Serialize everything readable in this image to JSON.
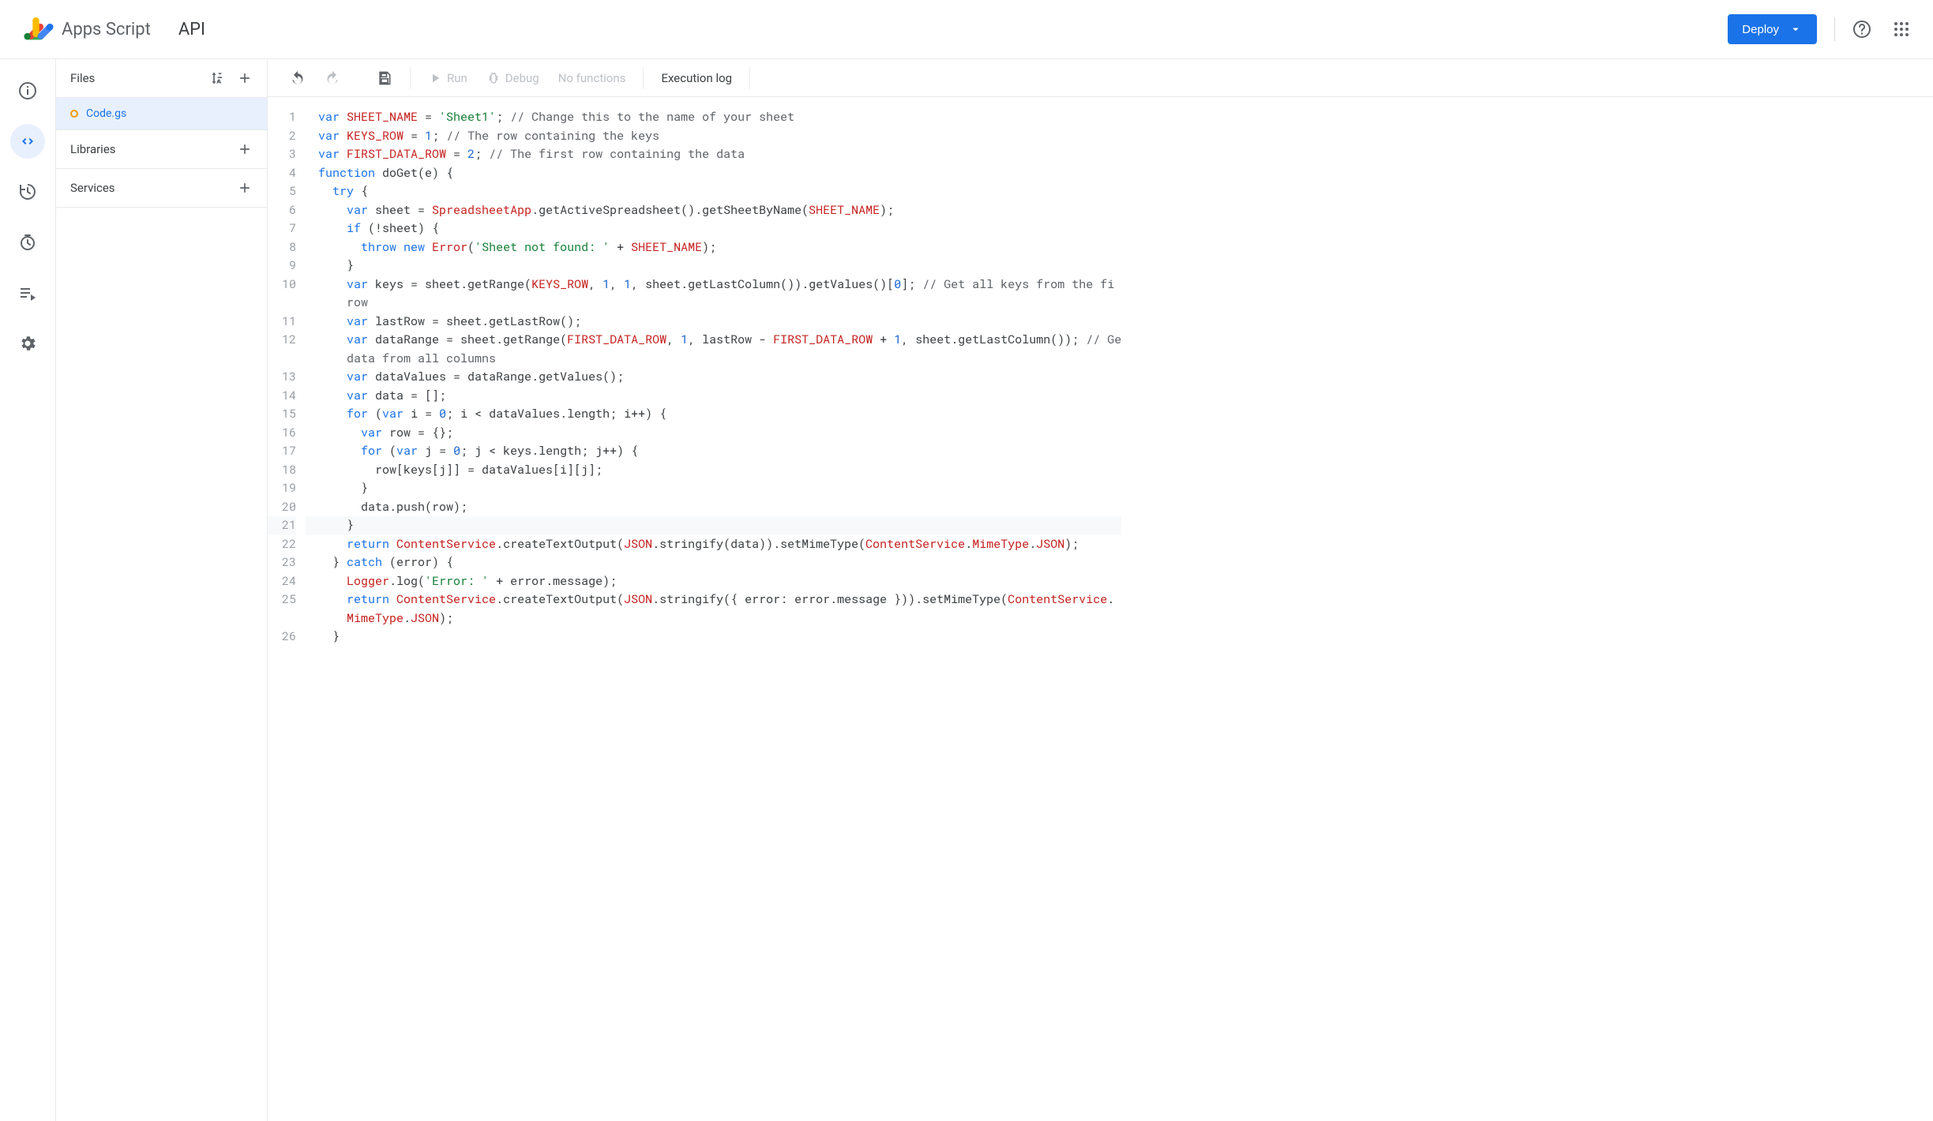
{
  "header": {
    "product": "Apps Script",
    "project_title": "API",
    "deploy_label": "Deploy"
  },
  "rail": {
    "items": [
      "overview",
      "editor",
      "triggers",
      "executions",
      "project-settings",
      "settings"
    ]
  },
  "files_panel": {
    "files_label": "Files",
    "libraries_label": "Libraries",
    "services_label": "Services",
    "file_items": [
      {
        "name": "Code.gs",
        "status": "unsaved"
      }
    ]
  },
  "toolbar": {
    "run_label": "Run",
    "debug_label": "Debug",
    "no_functions_label": "No functions",
    "execution_log_label": "Execution log"
  },
  "editor": {
    "line_numbers": [
      "1",
      "2",
      "3",
      "4",
      "5",
      "6",
      "7",
      "8",
      "9",
      "10",
      "",
      "11",
      "12",
      "",
      "13",
      "14",
      "15",
      "16",
      "17",
      "18",
      "19",
      "20",
      "21",
      "22",
      "23",
      "24",
      "25",
      "",
      "26"
    ],
    "current_line_index": 22,
    "code_lines": [
      [
        {
          "t": "var ",
          "c": "kw"
        },
        {
          "t": "SHEET_NAME",
          "c": "ident"
        },
        {
          "t": " = "
        },
        {
          "t": "'Sheet1'",
          "c": "str"
        },
        {
          "t": "; "
        },
        {
          "t": "// Change this to the name of your sheet",
          "c": "cmt"
        }
      ],
      [
        {
          "t": "var ",
          "c": "kw"
        },
        {
          "t": "KEYS_ROW",
          "c": "ident"
        },
        {
          "t": " = "
        },
        {
          "t": "1",
          "c": "num"
        },
        {
          "t": "; "
        },
        {
          "t": "// The row containing the keys",
          "c": "cmt"
        }
      ],
      [
        {
          "t": "var ",
          "c": "kw"
        },
        {
          "t": "FIRST_DATA_ROW",
          "c": "ident"
        },
        {
          "t": " = "
        },
        {
          "t": "2",
          "c": "num"
        },
        {
          "t": "; "
        },
        {
          "t": "// The first row containing the data",
          "c": "cmt"
        }
      ],
      [
        {
          "t": "function ",
          "c": "kw"
        },
        {
          "t": "doGet"
        },
        {
          "t": "(e) {"
        }
      ],
      [
        {
          "t": "  "
        },
        {
          "t": "try ",
          "c": "kw"
        },
        {
          "t": "{"
        }
      ],
      [
        {
          "t": "    "
        },
        {
          "t": "var ",
          "c": "kw"
        },
        {
          "t": "sheet = "
        },
        {
          "t": "SpreadsheetApp",
          "c": "ident"
        },
        {
          "t": ".getActiveSpreadsheet().getSheetByName("
        },
        {
          "t": "SHEET_NAME",
          "c": "ident"
        },
        {
          "t": ");"
        }
      ],
      [
        {
          "t": "    "
        },
        {
          "t": "if ",
          "c": "kw"
        },
        {
          "t": "(!sheet) {"
        }
      ],
      [
        {
          "t": "      "
        },
        {
          "t": "throw new ",
          "c": "kw"
        },
        {
          "t": "Error",
          "c": "err"
        },
        {
          "t": "("
        },
        {
          "t": "'Sheet not found: '",
          "c": "str"
        },
        {
          "t": " + "
        },
        {
          "t": "SHEET_NAME",
          "c": "ident"
        },
        {
          "t": ");"
        }
      ],
      [
        {
          "t": "    }"
        }
      ],
      [
        {
          "t": "    "
        },
        {
          "t": "var ",
          "c": "kw"
        },
        {
          "t": "keys = sheet.getRange("
        },
        {
          "t": "KEYS_ROW",
          "c": "ident"
        },
        {
          "t": ", "
        },
        {
          "t": "1",
          "c": "num"
        },
        {
          "t": ", "
        },
        {
          "t": "1",
          "c": "num"
        },
        {
          "t": ", sheet.getLastColumn()).getValues()["
        },
        {
          "t": "0",
          "c": "num"
        },
        {
          "t": "]; "
        },
        {
          "t": "// Get all keys from the fi",
          "c": "cmt"
        }
      ],
      [
        {
          "t": "    "
        },
        {
          "t": "row",
          "c": "cmt"
        }
      ],
      [
        {
          "t": "    "
        },
        {
          "t": "var ",
          "c": "kw"
        },
        {
          "t": "lastRow = sheet.getLastRow();"
        }
      ],
      [
        {
          "t": "    "
        },
        {
          "t": "var ",
          "c": "kw"
        },
        {
          "t": "dataRange = sheet.getRange("
        },
        {
          "t": "FIRST_DATA_ROW",
          "c": "ident"
        },
        {
          "t": ", "
        },
        {
          "t": "1",
          "c": "num"
        },
        {
          "t": ", lastRow - "
        },
        {
          "t": "FIRST_DATA_ROW",
          "c": "ident"
        },
        {
          "t": " + "
        },
        {
          "t": "1",
          "c": "num"
        },
        {
          "t": ", sheet.getLastColumn()); "
        },
        {
          "t": "// Ge",
          "c": "cmt"
        }
      ],
      [
        {
          "t": "    "
        },
        {
          "t": "data from all columns",
          "c": "cmt"
        }
      ],
      [
        {
          "t": "    "
        },
        {
          "t": "var ",
          "c": "kw"
        },
        {
          "t": "dataValues = dataRange.getValues();"
        }
      ],
      [
        {
          "t": "    "
        },
        {
          "t": "var ",
          "c": "kw"
        },
        {
          "t": "data = [];"
        }
      ],
      [
        {
          "t": "    "
        },
        {
          "t": "for ",
          "c": "kw"
        },
        {
          "t": "("
        },
        {
          "t": "var ",
          "c": "kw"
        },
        {
          "t": "i = "
        },
        {
          "t": "0",
          "c": "num"
        },
        {
          "t": "; i < dataValues.length; i++) {"
        }
      ],
      [
        {
          "t": "      "
        },
        {
          "t": "var ",
          "c": "kw"
        },
        {
          "t": "row = {};"
        }
      ],
      [
        {
          "t": "      "
        },
        {
          "t": "for ",
          "c": "kw"
        },
        {
          "t": "("
        },
        {
          "t": "var ",
          "c": "kw"
        },
        {
          "t": "j = "
        },
        {
          "t": "0",
          "c": "num"
        },
        {
          "t": "; j < keys.length; j++) {"
        }
      ],
      [
        {
          "t": "        row[keys[j]] = dataValues[i][j];"
        }
      ],
      [
        {
          "t": "      }"
        }
      ],
      [
        {
          "t": "      data.push(row);"
        }
      ],
      [
        {
          "t": "    }"
        }
      ],
      [
        {
          "t": "    "
        },
        {
          "t": "return ",
          "c": "kw"
        },
        {
          "t": "ContentService",
          "c": "ident"
        },
        {
          "t": ".createTextOutput("
        },
        {
          "t": "JSON",
          "c": "ident"
        },
        {
          "t": ".stringify(data)).setMimeType("
        },
        {
          "t": "ContentService",
          "c": "ident"
        },
        {
          "t": "."
        },
        {
          "t": "MimeType",
          "c": "ident"
        },
        {
          "t": "."
        },
        {
          "t": "JSON",
          "c": "ident"
        },
        {
          "t": ");"
        }
      ],
      [
        {
          "t": "  } "
        },
        {
          "t": "catch ",
          "c": "kw"
        },
        {
          "t": "(error) {"
        }
      ],
      [
        {
          "t": "    "
        },
        {
          "t": "Logger",
          "c": "ident"
        },
        {
          "t": ".log("
        },
        {
          "t": "'Error: '",
          "c": "str"
        },
        {
          "t": " + error.message);"
        }
      ],
      [
        {
          "t": "    "
        },
        {
          "t": "return ",
          "c": "kw"
        },
        {
          "t": "ContentService",
          "c": "ident"
        },
        {
          "t": ".createTextOutput("
        },
        {
          "t": "JSON",
          "c": "ident"
        },
        {
          "t": ".stringify({ error: error.message })).setMimeType("
        },
        {
          "t": "ContentService",
          "c": "ident"
        },
        {
          "t": "."
        }
      ],
      [
        {
          "t": "    "
        },
        {
          "t": "MimeType",
          "c": "ident"
        },
        {
          "t": "."
        },
        {
          "t": "JSON",
          "c": "ident"
        },
        {
          "t": ");"
        }
      ],
      [
        {
          "t": "  }"
        }
      ]
    ]
  }
}
